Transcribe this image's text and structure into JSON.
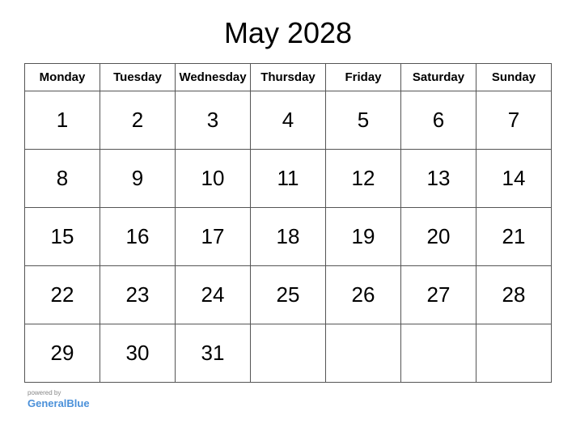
{
  "calendar": {
    "title": "May 2028",
    "headers": [
      "Monday",
      "Tuesday",
      "Wednesday",
      "Thursday",
      "Friday",
      "Saturday",
      "Sunday"
    ],
    "weeks": [
      [
        "1",
        "2",
        "3",
        "4",
        "5",
        "6",
        "7"
      ],
      [
        "8",
        "9",
        "10",
        "11",
        "12",
        "13",
        "14"
      ],
      [
        "15",
        "16",
        "17",
        "18",
        "19",
        "20",
        "21"
      ],
      [
        "22",
        "23",
        "24",
        "25",
        "26",
        "27",
        "28"
      ],
      [
        "29",
        "30",
        "31",
        "",
        "",
        "",
        ""
      ]
    ]
  },
  "footer": {
    "powered_by": "powered by",
    "brand_black": "General",
    "brand_blue": "Blue"
  }
}
